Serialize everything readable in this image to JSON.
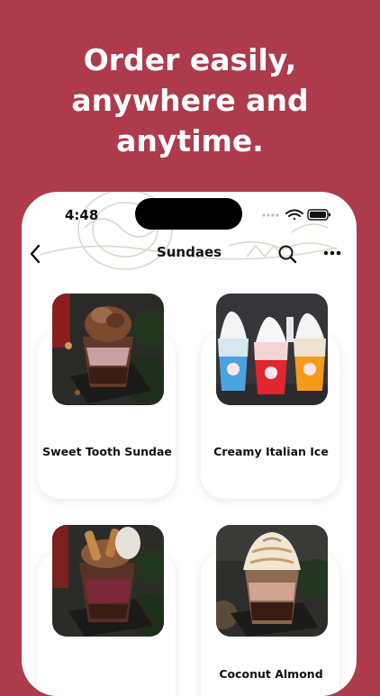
{
  "headline": {
    "line1": "Order easily,",
    "line2": "anywhere and",
    "line3": "anytime."
  },
  "status_bar": {
    "time": "4:48"
  },
  "nav": {
    "title": "Sundaes"
  },
  "products": [
    {
      "name": "Sweet Tooth Sundae"
    },
    {
      "name": "Creamy Italian Ice"
    },
    {
      "name": ""
    },
    {
      "name": "Coconut Almond"
    }
  ]
}
